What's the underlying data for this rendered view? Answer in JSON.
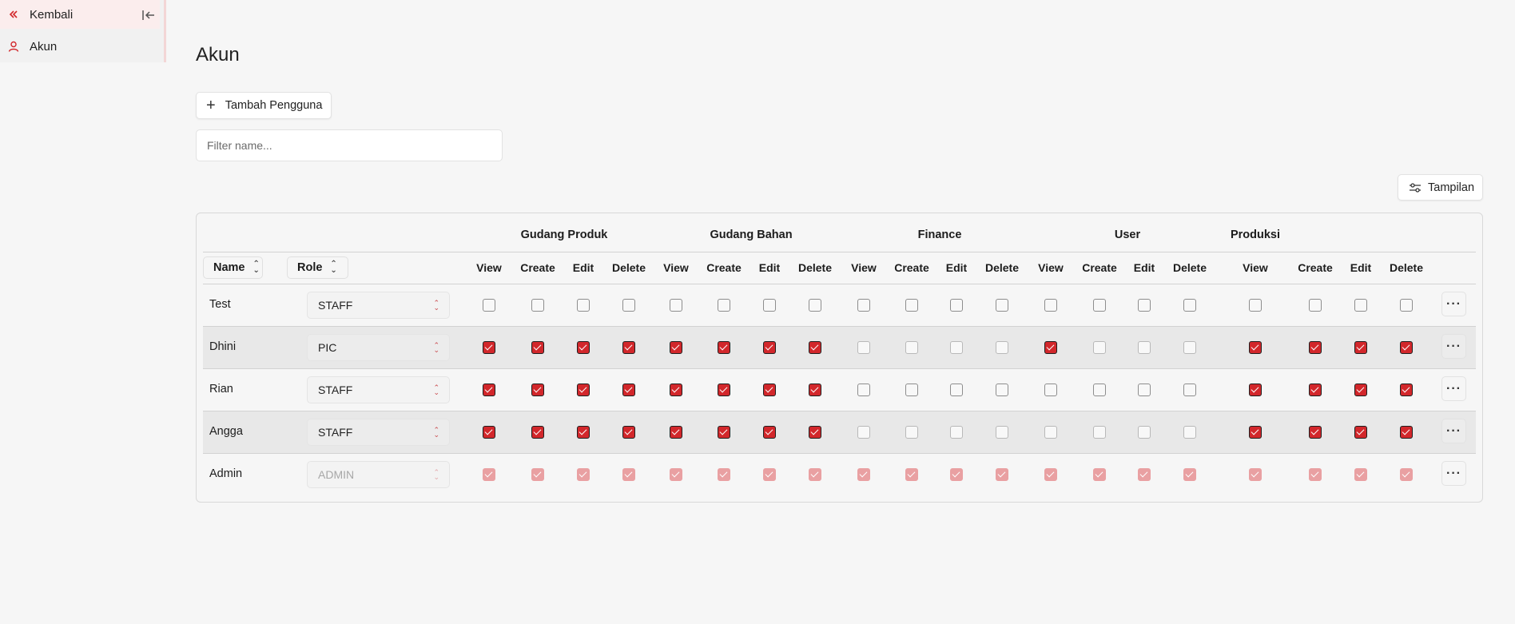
{
  "sidebar": {
    "back_label": "Kembali",
    "akun_label": "Akun"
  },
  "page": {
    "title": "Akun",
    "add_user_label": "Tambah Pengguna",
    "filter_placeholder": "Filter name...",
    "view_options_label": "Tampilan"
  },
  "table": {
    "name_header": "Name",
    "role_header": "Role",
    "groups": [
      "Gudang Produk",
      "Gudang Bahan",
      "Finance",
      "User",
      "Produksi"
    ],
    "permissions": [
      "View",
      "Create",
      "Edit",
      "Delete"
    ],
    "rows": [
      {
        "name": "Test",
        "role": "STAFF",
        "disabled": false,
        "perms": [
          0,
          0,
          0,
          0,
          0,
          0,
          0,
          0,
          0,
          0,
          0,
          0,
          0,
          0,
          0,
          0,
          0,
          0,
          0,
          0
        ]
      },
      {
        "name": "Dhini",
        "role": "PIC",
        "disabled": false,
        "perms": [
          1,
          1,
          1,
          1,
          1,
          1,
          1,
          1,
          0,
          0,
          0,
          0,
          1,
          0,
          0,
          0,
          1,
          1,
          1,
          1
        ]
      },
      {
        "name": "Rian",
        "role": "STAFF",
        "disabled": false,
        "perms": [
          1,
          1,
          1,
          1,
          1,
          1,
          1,
          1,
          0,
          0,
          0,
          0,
          0,
          0,
          0,
          0,
          1,
          1,
          1,
          1
        ]
      },
      {
        "name": "Angga",
        "role": "STAFF",
        "disabled": false,
        "perms": [
          1,
          1,
          1,
          1,
          1,
          1,
          1,
          1,
          0,
          0,
          0,
          0,
          0,
          0,
          0,
          0,
          1,
          1,
          1,
          1
        ]
      },
      {
        "name": "Admin",
        "role": "ADMIN",
        "disabled": true,
        "perms": [
          1,
          1,
          1,
          1,
          1,
          1,
          1,
          1,
          1,
          1,
          1,
          1,
          1,
          1,
          1,
          1,
          1,
          1,
          1,
          1
        ]
      }
    ]
  },
  "colors": {
    "accent": "#d2272b",
    "background": "#f6f6f6"
  }
}
